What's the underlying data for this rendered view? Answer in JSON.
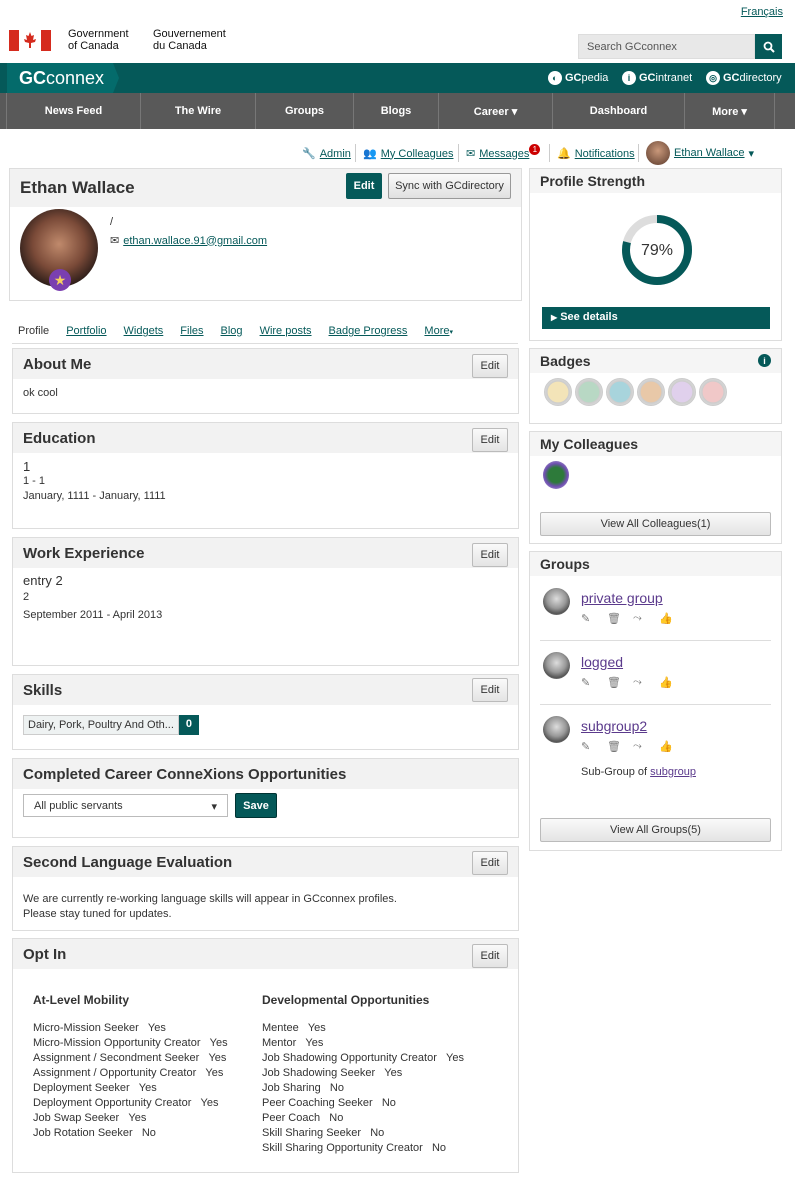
{
  "header": {
    "language_link": "Français",
    "gov_en_line1": "Government",
    "gov_en_line2": "of Canada",
    "gov_fr_line1": "Gouvernement",
    "gov_fr_line2": "du Canada",
    "search_placeholder": "Search GCconnex",
    "brand_gc": "GC",
    "brand_connex": "connex",
    "ext_links": [
      {
        "prefix": "GC",
        "suffix": "pedia"
      },
      {
        "prefix": "GC",
        "suffix": "intranet"
      },
      {
        "prefix": "GC",
        "suffix": "directory"
      }
    ]
  },
  "nav": [
    "News Feed",
    "The Wire",
    "Groups",
    "Blogs",
    "Career ▾",
    "Dashboard",
    "More ▾"
  ],
  "utility": {
    "admin": "Admin",
    "colleagues": "My Colleagues",
    "messages": "Messages",
    "messages_count": "1",
    "notifications": "Notifications",
    "user": "Ethan Wallace"
  },
  "profile": {
    "name": "Ethan Wallace",
    "edit": "Edit",
    "sync": "Sync with GCdirectory",
    "slash": "/",
    "email": "ethan.wallace.91@gmail.com"
  },
  "tabs": [
    "Profile",
    "Portfolio",
    "Widgets",
    "Files",
    "Blog",
    "Wire posts",
    "Badge Progress",
    "More"
  ],
  "about": {
    "title": "About Me",
    "text": "ok cool"
  },
  "education": {
    "title": "Education",
    "school": "1",
    "degree": "1 - 1",
    "dates": "January, 1111 - January, 1111"
  },
  "work": {
    "title": "Work Experience",
    "entry": "entry 2",
    "org": "2",
    "dates": "September 2011 - April 2013"
  },
  "skills": {
    "title": "Skills",
    "skill": "Dairy, Pork, Poultry And Oth...",
    "count": "0"
  },
  "career": {
    "title": "Completed Career ConneXions Opportunities",
    "select": "All public servants",
    "save": "Save"
  },
  "language": {
    "title": "Second Language Evaluation",
    "line1": "We are currently re-working language skills will appear in GCconnex profiles.",
    "line2": "Please stay tuned for updates."
  },
  "optin": {
    "title": "Opt In",
    "col1_title": "At-Level Mobility",
    "col1": [
      [
        "Micro-Mission Seeker",
        "Yes"
      ],
      [
        "Micro-Mission Opportunity Creator",
        "Yes"
      ],
      [
        "Assignment / Secondment Seeker",
        "Yes"
      ],
      [
        "Assignment / Opportunity Creator",
        "Yes"
      ],
      [
        "Deployment Seeker",
        "Yes"
      ],
      [
        "Deployment Opportunity Creator",
        "Yes"
      ],
      [
        "Job Swap Seeker",
        "Yes"
      ],
      [
        "Job Rotation Seeker",
        "No"
      ]
    ],
    "col2_title": "Developmental Opportunities",
    "col2": [
      [
        "Mentee",
        "Yes"
      ],
      [
        "Mentor",
        "Yes"
      ],
      [
        "Job Shadowing Opportunity Creator",
        "Yes"
      ],
      [
        "Job Shadowing Seeker",
        "Yes"
      ],
      [
        "Job Sharing",
        "No"
      ],
      [
        "Peer Coaching Seeker",
        "No"
      ],
      [
        "Peer Coach",
        "No"
      ],
      [
        "Skill Sharing Seeker",
        "No"
      ],
      [
        "Skill Sharing Opportunity Creator",
        "No"
      ]
    ]
  },
  "strength": {
    "title": "Profile Strength",
    "percent": "79%",
    "fraction": 0.79,
    "details": "See details"
  },
  "badges": {
    "title": "Badges",
    "colors": [
      "#f3e4b8",
      "#b8d8c4",
      "#a8d4dc",
      "#e8c8a8",
      "#e0d0ec",
      "#f0c8c8"
    ]
  },
  "colleagues": {
    "title": "My Colleagues",
    "view_all": "View All Colleagues(1)"
  },
  "groups": {
    "title": "Groups",
    "items": [
      "private group",
      "logged",
      "subgroup2"
    ],
    "sub_prefix": "Sub-Group of",
    "sub_link": "subgroup",
    "view_all": "View All Groups(5)"
  },
  "colors": {
    "primary": "#055959",
    "nav": "#595959",
    "flag_red": "#d52b1e"
  }
}
